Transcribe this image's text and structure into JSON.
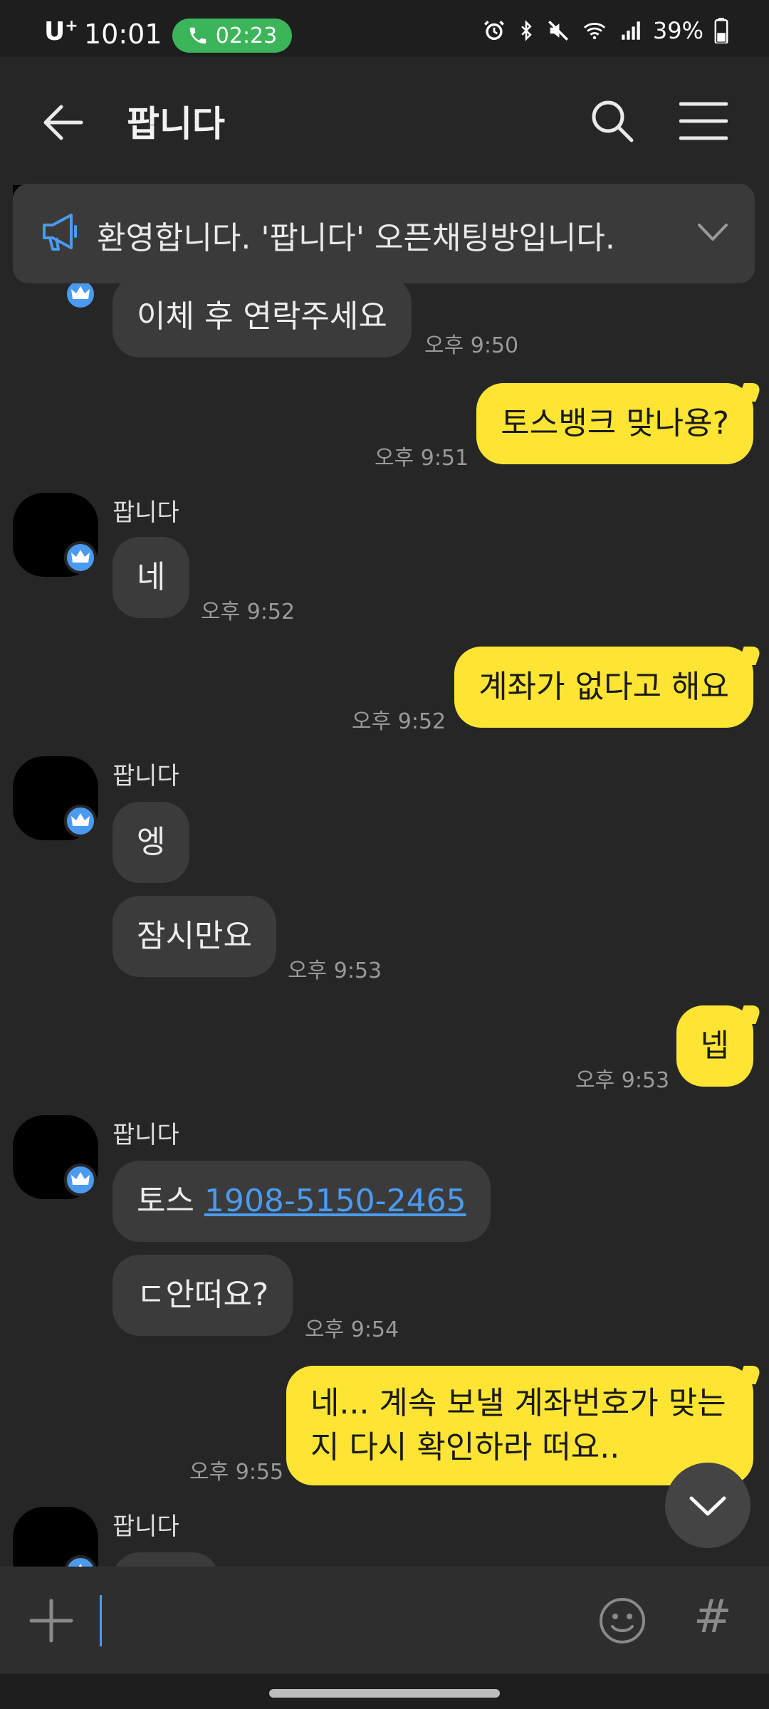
{
  "status_bar": {
    "carrier": "U",
    "carrier_sup": "+",
    "time": "10:01",
    "call_timer": "02:23",
    "battery": "39%"
  },
  "header": {
    "title": "팝니다"
  },
  "notice": {
    "text": "환영합니다. '팝니다' 오픈채팅방입니다."
  },
  "messages": {
    "m1": {
      "text": "이체 후 연락주세요",
      "time": "오후 9:50"
    },
    "m2": {
      "text": "토스뱅크 맞나용?",
      "time": "오후 9:51"
    },
    "m3": {
      "sender": "팝니다",
      "text": "네",
      "time": "오후 9:52"
    },
    "m4": {
      "text": "계좌가 없다고 해요",
      "time": "오후 9:52"
    },
    "m5": {
      "sender": "팝니다",
      "text": "엥"
    },
    "m6": {
      "text": "잠시만요",
      "time": "오후 9:53"
    },
    "m7": {
      "text": "넵",
      "time": "오후 9:53"
    },
    "m8": {
      "sender": "팝니다",
      "prefix": "토스 ",
      "link": "1908-5150-2465"
    },
    "m9": {
      "text": "ㄷ안떠요?",
      "time": "오후 9:54"
    },
    "m10": {
      "line1": "네... 계속 보낼 계좌번호가 맞는",
      "line2": "지 다시 확인하라 떠요..",
      "time": "오후 9:55"
    },
    "m11": {
      "sender": "팝니다"
    }
  },
  "input": {
    "placeholder": "",
    "hash": "#"
  },
  "colors": {
    "background": "#262626",
    "outgoing_bubble": "#fee533",
    "incoming_bubble": "#3b3b3b",
    "accent": "#4a9bf0",
    "call_pill": "#3cb55a"
  },
  "icons": [
    "back-arrow-icon",
    "search-icon",
    "menu-icon",
    "megaphone-icon",
    "chevron-down-icon",
    "crown-icon",
    "plus-icon",
    "emoji-icon",
    "hash-icon",
    "phone-icon",
    "alarm-icon",
    "bluetooth-icon",
    "mute-icon",
    "wifi-icon",
    "signal-icon",
    "battery-icon"
  ]
}
